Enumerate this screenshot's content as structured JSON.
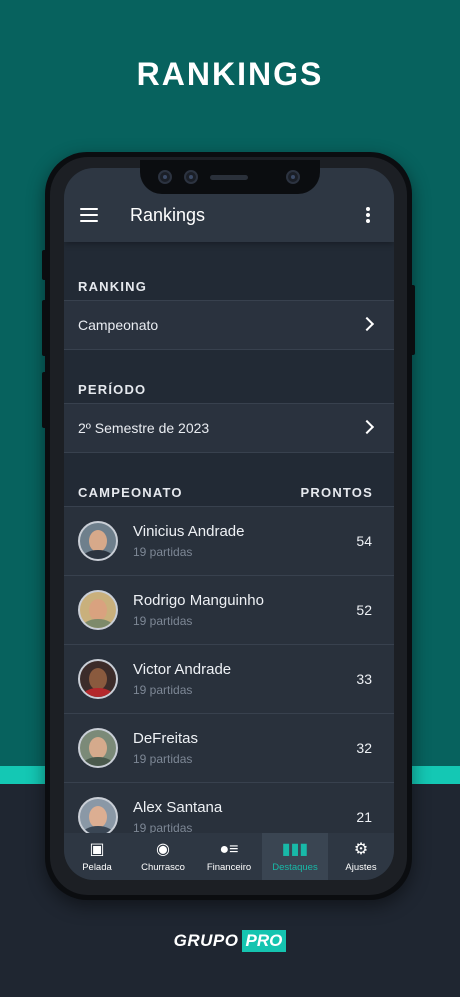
{
  "headline": "RANKINGS",
  "appbar": {
    "title": "Rankings"
  },
  "ranking_section": {
    "label": "RANKING",
    "value": "Campeonato"
  },
  "periodo_section": {
    "label": "PERÍODO",
    "value": "2º Semestre de 2023"
  },
  "list_header": {
    "left": "CAMPEONATO",
    "right": "PRONTOS"
  },
  "players": [
    {
      "name": "Vinicius Andrade",
      "matches": "19 partidas",
      "points": "54"
    },
    {
      "name": "Rodrigo Manguinho",
      "matches": "19 partidas",
      "points": "52"
    },
    {
      "name": "Victor Andrade",
      "matches": "19 partidas",
      "points": "33"
    },
    {
      "name": "DeFreitas",
      "matches": "19 partidas",
      "points": "32"
    },
    {
      "name": "Alex Santana",
      "matches": "19 partidas",
      "points": "21"
    }
  ],
  "nav": [
    {
      "label": "Pelada",
      "icon": "pitch-icon"
    },
    {
      "label": "Churrasco",
      "icon": "grill-icon"
    },
    {
      "label": "Financeiro",
      "icon": "coins-icon"
    },
    {
      "label": "Destaques",
      "icon": "highlights-icon"
    },
    {
      "label": "Ajustes",
      "icon": "gear-icon"
    }
  ],
  "brand": {
    "word": "GRUPO",
    "badge": "PRO"
  },
  "colors": {
    "teal_bg": "#07625e",
    "accent": "#14c8b4",
    "dark_bg": "#1f2631",
    "active_tab": "#18b9a8"
  }
}
